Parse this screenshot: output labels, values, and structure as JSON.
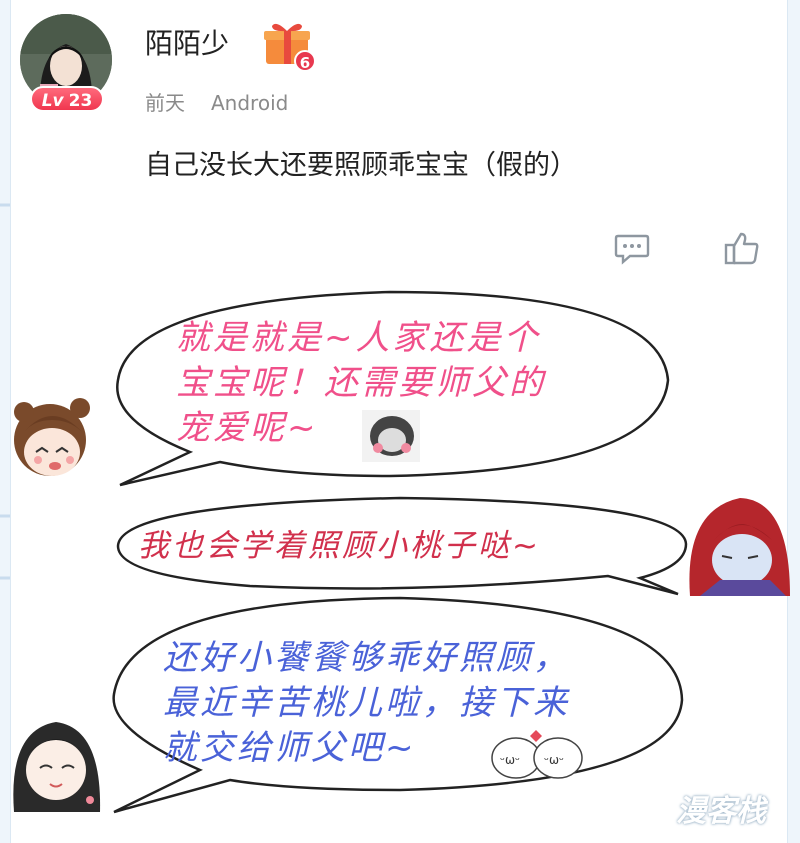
{
  "post": {
    "username": "陌陌少",
    "level_prefix": "Lv",
    "level": "23",
    "gift_count": "6",
    "time": "前天",
    "device": "Android",
    "content": "自己没长大还要照顾乖宝宝（假的）"
  },
  "actions": {
    "comment_icon": "comment-icon",
    "like_icon": "thumbs-up-icon"
  },
  "comic": {
    "bubble1": [
      "就是就是~人家还是个",
      "宝宝呢！还需要师父的",
      "宠爱呢~"
    ],
    "bubble2": "我也会学着照顾小桃子哒~",
    "bubble3": [
      "还好小饕餮够乖好照顾，",
      "最近辛苦桃儿啦，接下来",
      "就交给师父吧~"
    ]
  },
  "watermark": "漫客栈",
  "colors": {
    "bubble1_text": "#f0508a",
    "bubble2_text": "#d1304c",
    "bubble3_text": "#4a62d8",
    "level_badge": "#f0364f"
  }
}
